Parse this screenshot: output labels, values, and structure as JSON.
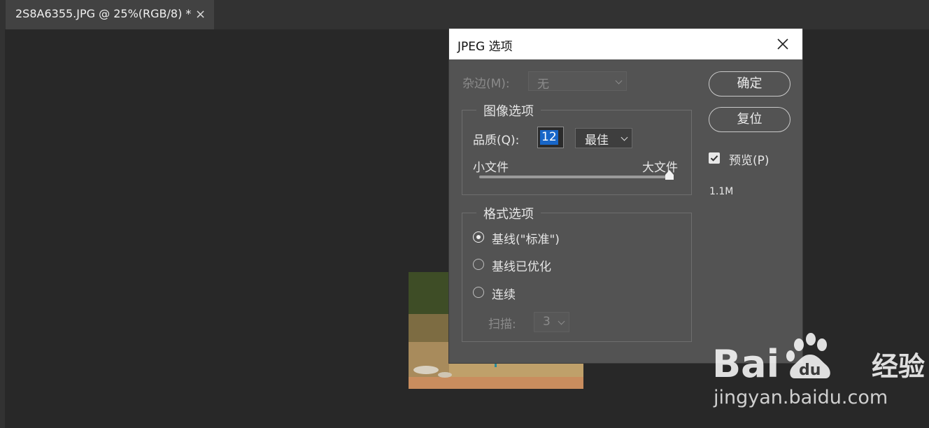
{
  "document_tab": {
    "title": "2S8A6355.JPG @ 25%(RGB/8) *",
    "close_glyph": "×"
  },
  "dialog": {
    "title": "JPEG 选项",
    "close_icon": "close-icon",
    "matte": {
      "label": "杂边(M):",
      "value": "无",
      "enabled": false
    },
    "image_options": {
      "legend": "图像选项",
      "quality_label": "品质(Q):",
      "quality_value": "12",
      "quality_preset": "最佳",
      "slider_min_label": "小文件",
      "slider_max_label": "大文件",
      "slider_value": 1.0
    },
    "format_options": {
      "legend": "格式选项",
      "options": [
        {
          "label": "基线(\"标准\")",
          "selected": true
        },
        {
          "label": "基线已优化",
          "selected": false
        },
        {
          "label": "连续",
          "selected": false
        }
      ],
      "scans_label": "扫描:",
      "scans_value": "3"
    },
    "buttons": {
      "ok": "确定",
      "reset": "复位"
    },
    "preview": {
      "label": "预览(P)",
      "checked": true
    },
    "file_size": "1.1M"
  },
  "watermark": {
    "brand": "Bai du 经验",
    "url": "jingyan.baidu.com"
  },
  "colors": {
    "canvas_bg": "#282828",
    "dialog_bg": "#535353",
    "selection_blue": "#1866c8"
  }
}
